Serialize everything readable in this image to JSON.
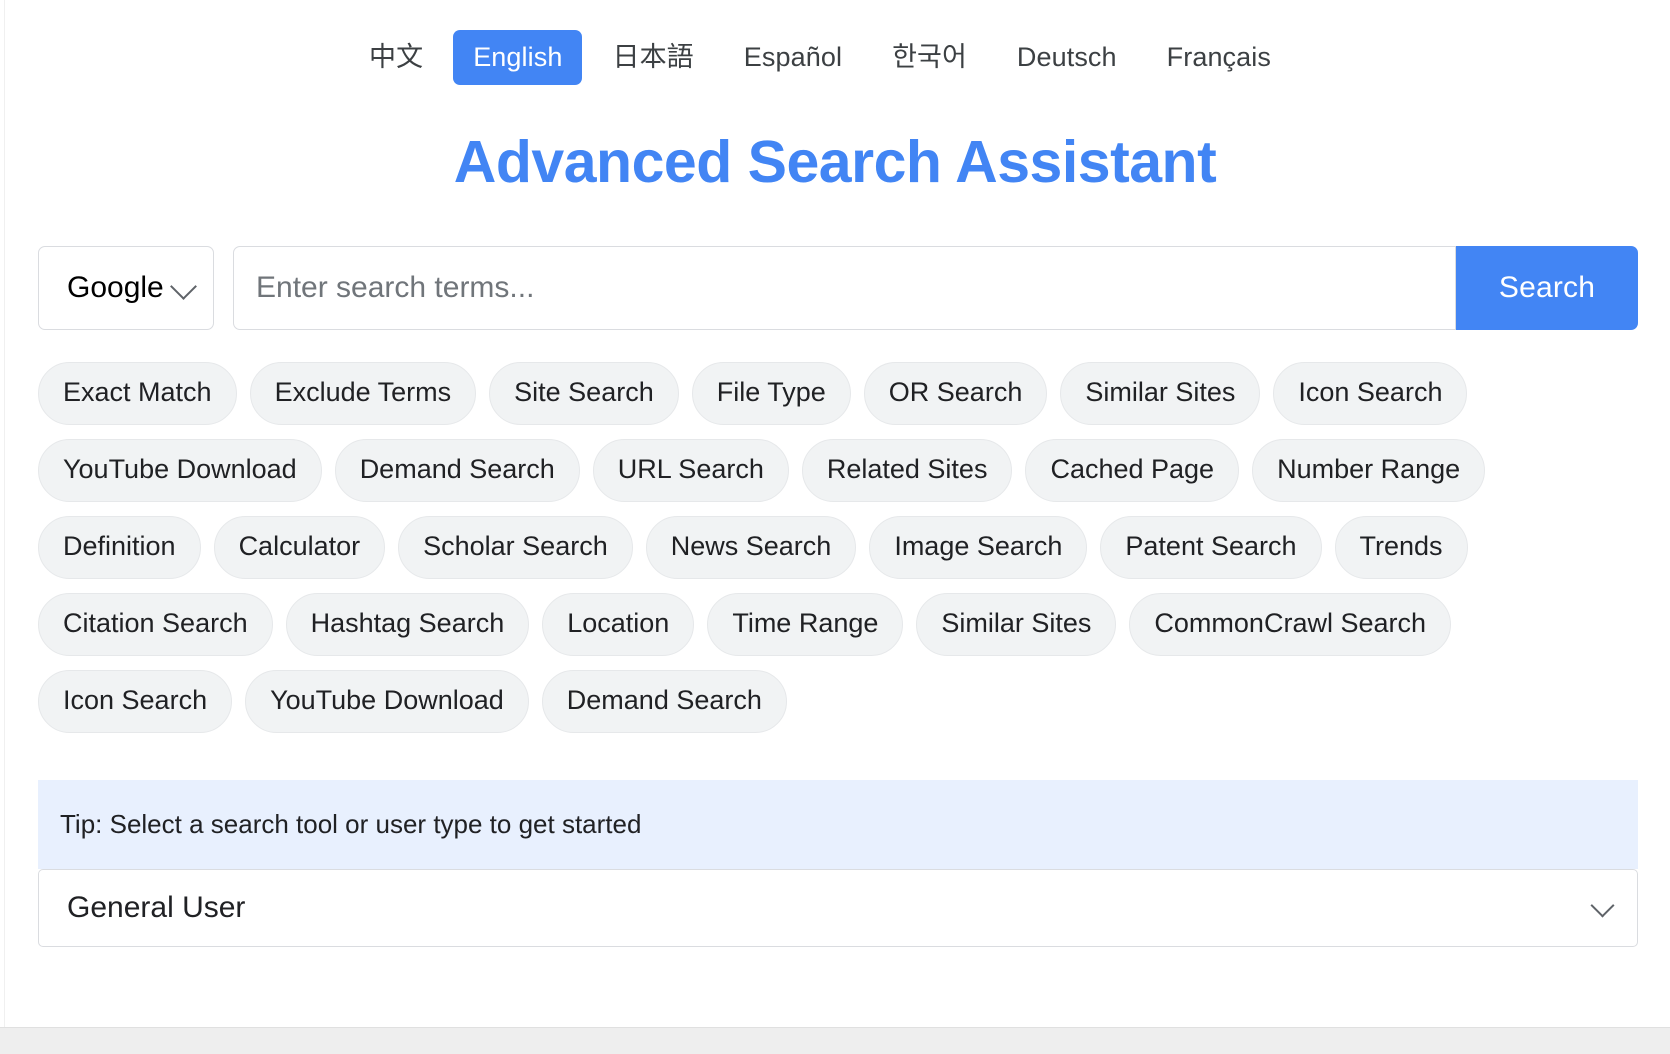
{
  "language_bar": {
    "items": [
      {
        "label": "中文",
        "active": false
      },
      {
        "label": "English",
        "active": true
      },
      {
        "label": "日本語",
        "active": false
      },
      {
        "label": "Español",
        "active": false
      },
      {
        "label": "한국어",
        "active": false
      },
      {
        "label": "Deutsch",
        "active": false
      },
      {
        "label": "Français",
        "active": false
      }
    ]
  },
  "page_title": "Advanced Search Assistant",
  "search": {
    "engine_selected": "Google",
    "input_value": "",
    "input_placeholder": "Enter search terms...",
    "button_label": "Search"
  },
  "tags": [
    "Exact Match",
    "Exclude Terms",
    "Site Search",
    "File Type",
    "OR Search",
    "Similar Sites",
    "Icon Search",
    "YouTube Download",
    "Demand Search",
    "URL Search",
    "Related Sites",
    "Cached Page",
    "Number Range",
    "Definition",
    "Calculator",
    "Scholar Search",
    "News Search",
    "Image Search",
    "Patent Search",
    "Trends",
    "Citation Search",
    "Hashtag Search",
    "Location",
    "Time Range",
    "Similar Sites",
    "CommonCrawl Search",
    "Icon Search",
    "YouTube Download",
    "Demand Search"
  ],
  "tip": {
    "text": "Tip: Select a search tool or user type to get started"
  },
  "user_type": {
    "selected": "General User"
  },
  "colors": {
    "accent": "#4285f4",
    "tag_bg": "#f1f3f4",
    "tip_bg": "#e8f0fe",
    "border": "#dadce0"
  }
}
